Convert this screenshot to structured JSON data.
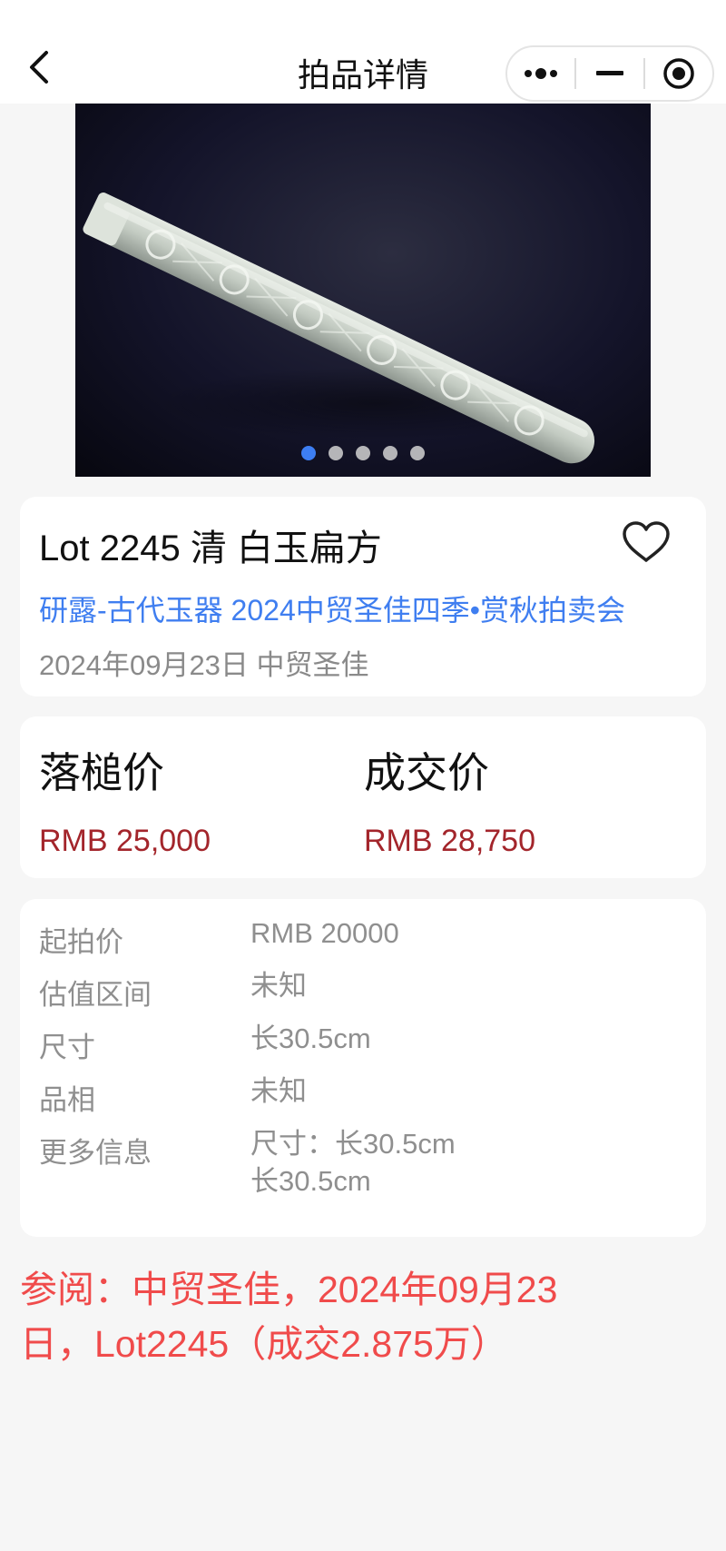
{
  "nav": {
    "title": "拍品详情",
    "back_icon": "chevron-left-icon",
    "capsule": {
      "more_icon": "more-dots-icon",
      "minimize_icon": "minimize-icon",
      "close_icon": "target-close-icon"
    }
  },
  "gallery": {
    "image_count": 5,
    "active_index": 0
  },
  "lot": {
    "title": "Lot 2245 清 白玉扁方",
    "auction": "研露-古代玉器 2024中贸圣佳四季•赏秋拍卖会",
    "date_house": "2024年09月23日 中贸圣佳",
    "favorite_icon": "heart-outline-icon"
  },
  "prices": {
    "hammer_label": "落槌价",
    "hammer_value": "RMB 25,000",
    "sold_label": "成交价",
    "sold_value": "RMB 28,750",
    "value_color": "#a3252b"
  },
  "details": [
    {
      "label": "起拍价",
      "value": "RMB 20000"
    },
    {
      "label": "估值区间",
      "value": "未知"
    },
    {
      "label": "尺寸",
      "value": "长30.5cm"
    },
    {
      "label": "品相",
      "value": "未知"
    },
    {
      "label": "更多信息",
      "value": "尺寸：长30.5cm",
      "value2": "长30.5cm"
    }
  ],
  "reference": {
    "line1": "参阅：中贸圣佳，2024年09月23",
    "line2": "日，Lot2245（成交2.875万）",
    "color": "#f04b4b"
  },
  "colors": {
    "accent": "#3f7ef0",
    "background": "#f6f6f6"
  }
}
